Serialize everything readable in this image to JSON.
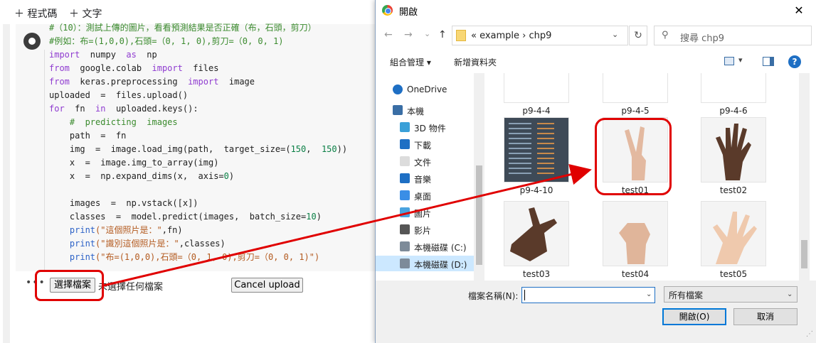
{
  "colab": {
    "toolbar": {
      "code_btn": "＋ 程式碼",
      "text_btn": "＋ 文字"
    },
    "code_lines": [
      [
        {
          "c": "cm",
          "t": "#（10）：測試上傳的圖片，看看預測結果是否正確（布，石頭，剪刀）"
        }
      ],
      [
        {
          "c": "cm",
          "t": "#例如：布=(1,0,0),石頭=（0, 1, 0),剪刀=（0, 0, 1)"
        }
      ],
      [
        {
          "c": "kw",
          "t": "import"
        },
        {
          "c": "",
          "t": "  numpy  "
        },
        {
          "c": "kw",
          "t": "as"
        },
        {
          "c": "",
          "t": "  np"
        }
      ],
      [
        {
          "c": "kw",
          "t": "from"
        },
        {
          "c": "",
          "t": "  google.colab  "
        },
        {
          "c": "kw",
          "t": "import"
        },
        {
          "c": "",
          "t": "  files"
        }
      ],
      [
        {
          "c": "kw",
          "t": "from"
        },
        {
          "c": "",
          "t": "  keras.preprocessing  "
        },
        {
          "c": "kw",
          "t": "import"
        },
        {
          "c": "",
          "t": "  image"
        }
      ],
      [
        {
          "c": "",
          "t": "uploaded  =  files.upload()"
        }
      ],
      [
        {
          "c": "kw",
          "t": "for"
        },
        {
          "c": "",
          "t": "  fn  "
        },
        {
          "c": "kw",
          "t": "in"
        },
        {
          "c": "",
          "t": "  uploaded.keys():"
        }
      ],
      [
        {
          "c": "cm",
          "t": "    #  predicting  images"
        }
      ],
      [
        {
          "c": "",
          "t": "    path  =  fn"
        }
      ],
      [
        {
          "c": "",
          "t": "    img  =  image.load_img(path,  target_size=("
        },
        {
          "c": "nm",
          "t": "150"
        },
        {
          "c": "",
          "t": ",  "
        },
        {
          "c": "nm",
          "t": "150"
        },
        {
          "c": "",
          "t": "))"
        }
      ],
      [
        {
          "c": "",
          "t": "    x  =  image.img_to_array(img)"
        }
      ],
      [
        {
          "c": "",
          "t": "    x  =  np.expand_dims(x,  axis="
        },
        {
          "c": "nm",
          "t": "0"
        },
        {
          "c": "",
          "t": ")"
        }
      ],
      [
        {
          "c": "",
          "t": " "
        }
      ],
      [
        {
          "c": "",
          "t": "    images  =  np.vstack([x])"
        }
      ],
      [
        {
          "c": "",
          "t": "    classes  =  model.predict(images,  batch_size="
        },
        {
          "c": "nm",
          "t": "10"
        },
        {
          "c": "",
          "t": ")"
        }
      ],
      [
        {
          "c": "",
          "t": "    "
        },
        {
          "c": "kw2",
          "t": "print"
        },
        {
          "c": "st",
          "t": "(\"這個照片是：\""
        },
        {
          "c": "",
          "t": ",fn)"
        }
      ],
      [
        {
          "c": "",
          "t": "    "
        },
        {
          "c": "kw2",
          "t": "print"
        },
        {
          "c": "st",
          "t": "(\"識別這個照片是：\""
        },
        {
          "c": "",
          "t": ",classes)"
        }
      ],
      [
        {
          "c": "",
          "t": "    "
        },
        {
          "c": "kw2",
          "t": "print"
        },
        {
          "c": "st",
          "t": "(\"布=(1,0,0),石頭=（0, 1, 0),剪刀=（0, 0, 1)\")"
        }
      ]
    ],
    "output": {
      "dots": "•••",
      "choose_btn": "選擇檔案",
      "no_file": "未選擇任何檔案",
      "cancel_upload": "Cancel upload"
    }
  },
  "dialog": {
    "title": "開啟",
    "close": "✕",
    "nav": {
      "back": "←",
      "forward": "→",
      "recent": "⌄",
      "up": "↑"
    },
    "address": {
      "path": "«  example  ›  chp9",
      "dropdown": "⌄",
      "refresh": "↻"
    },
    "search": {
      "icon": "⚲",
      "placeholder": "搜尋 chp9"
    },
    "command_bar": {
      "organize": "組合管理 ▾",
      "new_folder": "新增資料夾",
      "view_dd": "▾",
      "help": "?"
    },
    "sidebar": [
      {
        "label": "OneDrive",
        "icon": "cloud-icon"
      },
      {
        "label": "本機",
        "icon": "computer-icon"
      },
      {
        "label": "3D 物件",
        "icon": "cube-icon"
      },
      {
        "label": "下載",
        "icon": "download-icon"
      },
      {
        "label": "文件",
        "icon": "document-icon"
      },
      {
        "label": "音樂",
        "icon": "music-icon"
      },
      {
        "label": "桌面",
        "icon": "desktop-icon"
      },
      {
        "label": "圖片",
        "icon": "picture-icon"
      },
      {
        "label": "影片",
        "icon": "video-icon"
      },
      {
        "label": "本機磁碟 (C:)",
        "icon": "drive-icon"
      },
      {
        "label": "本機磁碟 (D:)",
        "icon": "drive-icon"
      }
    ],
    "files": [
      {
        "name": "p9-4-4",
        "kind": "doc"
      },
      {
        "name": "p9-4-5",
        "kind": "doc"
      },
      {
        "name": "p9-4-6",
        "kind": "plot"
      },
      {
        "name": "p9-4-10",
        "kind": "terminal"
      },
      {
        "name": "test01",
        "kind": "hand-scissors"
      },
      {
        "name": "test02",
        "kind": "hand-paper-dark"
      },
      {
        "name": "test03",
        "kind": "hand-dark"
      },
      {
        "name": "test04",
        "kind": "hand-rock"
      },
      {
        "name": "test05",
        "kind": "hand-paper"
      }
    ],
    "bottom": {
      "filename_label": "檔案名稱(N):",
      "filename_value": "",
      "filetype": "所有檔案",
      "open_btn": "開啟(O)",
      "cancel_btn": "取消",
      "dd": "⌄",
      "grip": "⋰"
    }
  },
  "colors": {
    "annotation": "#e00000",
    "selection": "#cce8ff",
    "accent": "#0078d7"
  }
}
